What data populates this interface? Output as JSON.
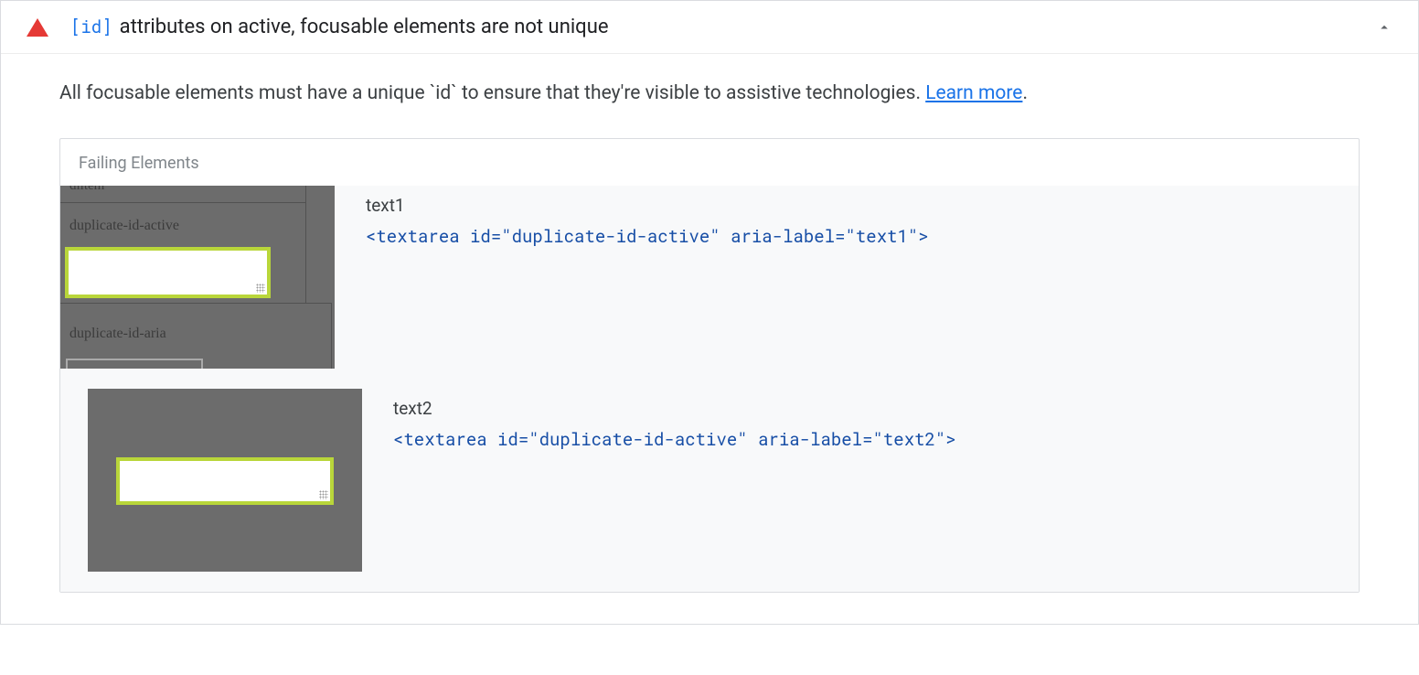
{
  "audit": {
    "code_tag": "[id]",
    "title_rest": " attributes on active, focusable elements are not unique",
    "description": "All focusable elements must have a unique `id` to ensure that they're visible to assistive technologies. ",
    "learn_more": "Learn more",
    "description_period": "."
  },
  "failing": {
    "header": "Failing Elements",
    "items": [
      {
        "label": "text1",
        "code": "<textarea id=\"duplicate-id-active\" aria-label=\"text1\">",
        "thumb": {
          "top_crop": "dlitem",
          "section1": "duplicate-id-active",
          "section2": "duplicate-id-aria"
        }
      },
      {
        "label": "text2",
        "code": "<textarea id=\"duplicate-id-active\" aria-label=\"text2\">"
      }
    ]
  }
}
